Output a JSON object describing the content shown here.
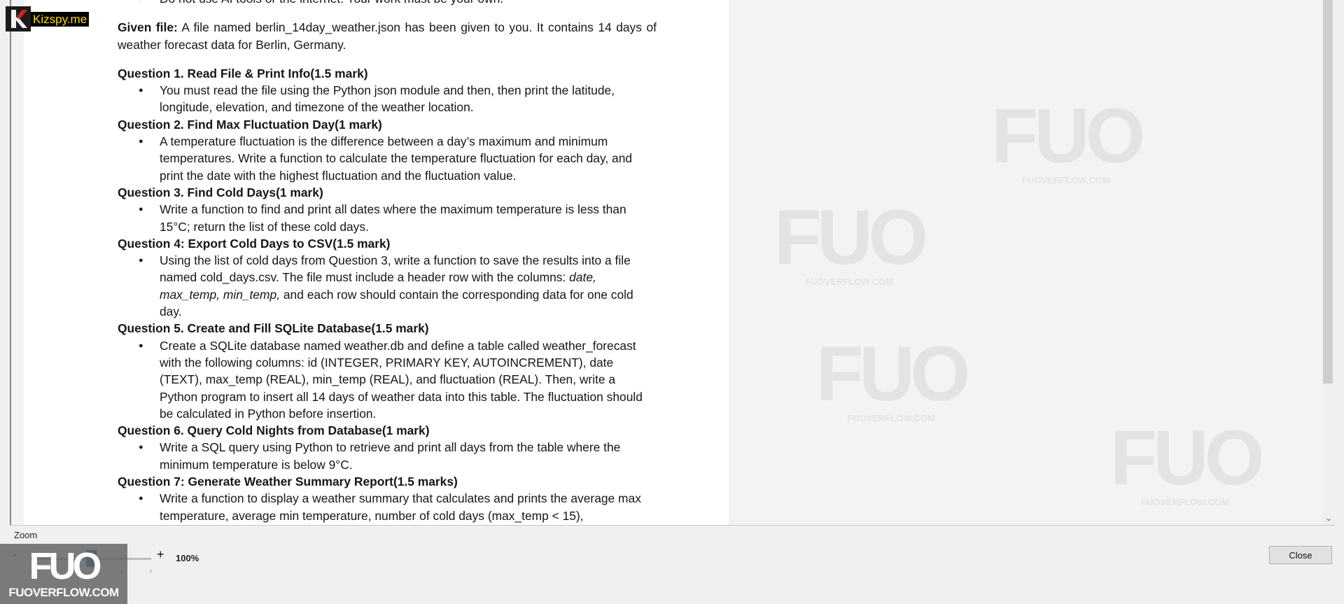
{
  "document": {
    "top_cut_line": "Do not use AI tools or the internet. Your work must be your own.",
    "given": {
      "label": "Given file:",
      "text": " A file named berlin_14day_weather.json has been given to you. It contains 14 days of weather forecast data for Berlin, Germany."
    },
    "q1": {
      "heading": "Question 1. Read File & Print Info(1.5 mark)",
      "bullet": "You must read the file using the Python json module and then, then print the latitude, longitude, elevation, and timezone of the weather location."
    },
    "q2": {
      "heading": "Question 2. Find Max Fluctuation Day(1 mark)",
      "bullet": "A temperature fluctuation is the difference between a day’s maximum and minimum temperatures. Write a function to calculate the temperature fluctuation for each day, and print the date with the highest fluctuation and the fluctuation value."
    },
    "q3": {
      "heading": "Question 3. Find Cold Days(1 mark)",
      "bullet": "Write a function to find and print all dates where the maximum temperature is less than 15°C; return the list of these cold days."
    },
    "q4": {
      "heading": "Question 4: Export Cold Days to CSV(1.5 mark)",
      "bullet_pre": "Using the list of cold days from Question 3, write a function to save the results into a file named cold_days.csv. The file must include a header row with the columns: ",
      "bullet_cols": "date, max_temp, min_temp,",
      "bullet_post": " and each row should contain the corresponding data for one cold day."
    },
    "q5": {
      "heading": "Question 5. Create and Fill SQLite Database(1.5 mark)",
      "bullet": "Create a SQLite database named weather.db and define a table called weather_forecast with the following columns: id (INTEGER, PRIMARY KEY, AUTOINCREMENT), date (TEXT), max_temp (REAL), min_temp (REAL), and fluctuation (REAL). Then, write a Python program to insert all 14 days of weather data into this table. The fluctuation should be calculated in Python before insertion."
    },
    "q6": {
      "heading": "Question 6. Query Cold Nights from Database(1 mark)",
      "bullet": "Write a SQL query using Python to retrieve and print all days from the table where the minimum temperature is below 9°C."
    },
    "q7": {
      "heading": "Question 7: Generate Weather Summary Report(1.5 marks)",
      "bullet": "Write a function to display a weather summary that calculates and prints the average max temperature, average min temperature, number of cold days (max_temp < 15),"
    }
  },
  "controls": {
    "zoom_label": "Zoom",
    "zoom_minus": "-",
    "zoom_plus": "+",
    "zoom_value": "100%",
    "zoom_level": 0.5,
    "close_label": "Close"
  },
  "overlays": {
    "kizspy_text": "Kizspy.me",
    "fuo_mark": "FUO",
    "fuo_text": "FUOVERFLOW.COM",
    "watermark_mark": "FUO",
    "watermark_text": "FUOVERFLOW.COM"
  },
  "colors": {
    "zoom_thumb": "#2f78c4",
    "kizspy_text": "#ffd700",
    "kizspy_k": "#cc1f1f"
  }
}
